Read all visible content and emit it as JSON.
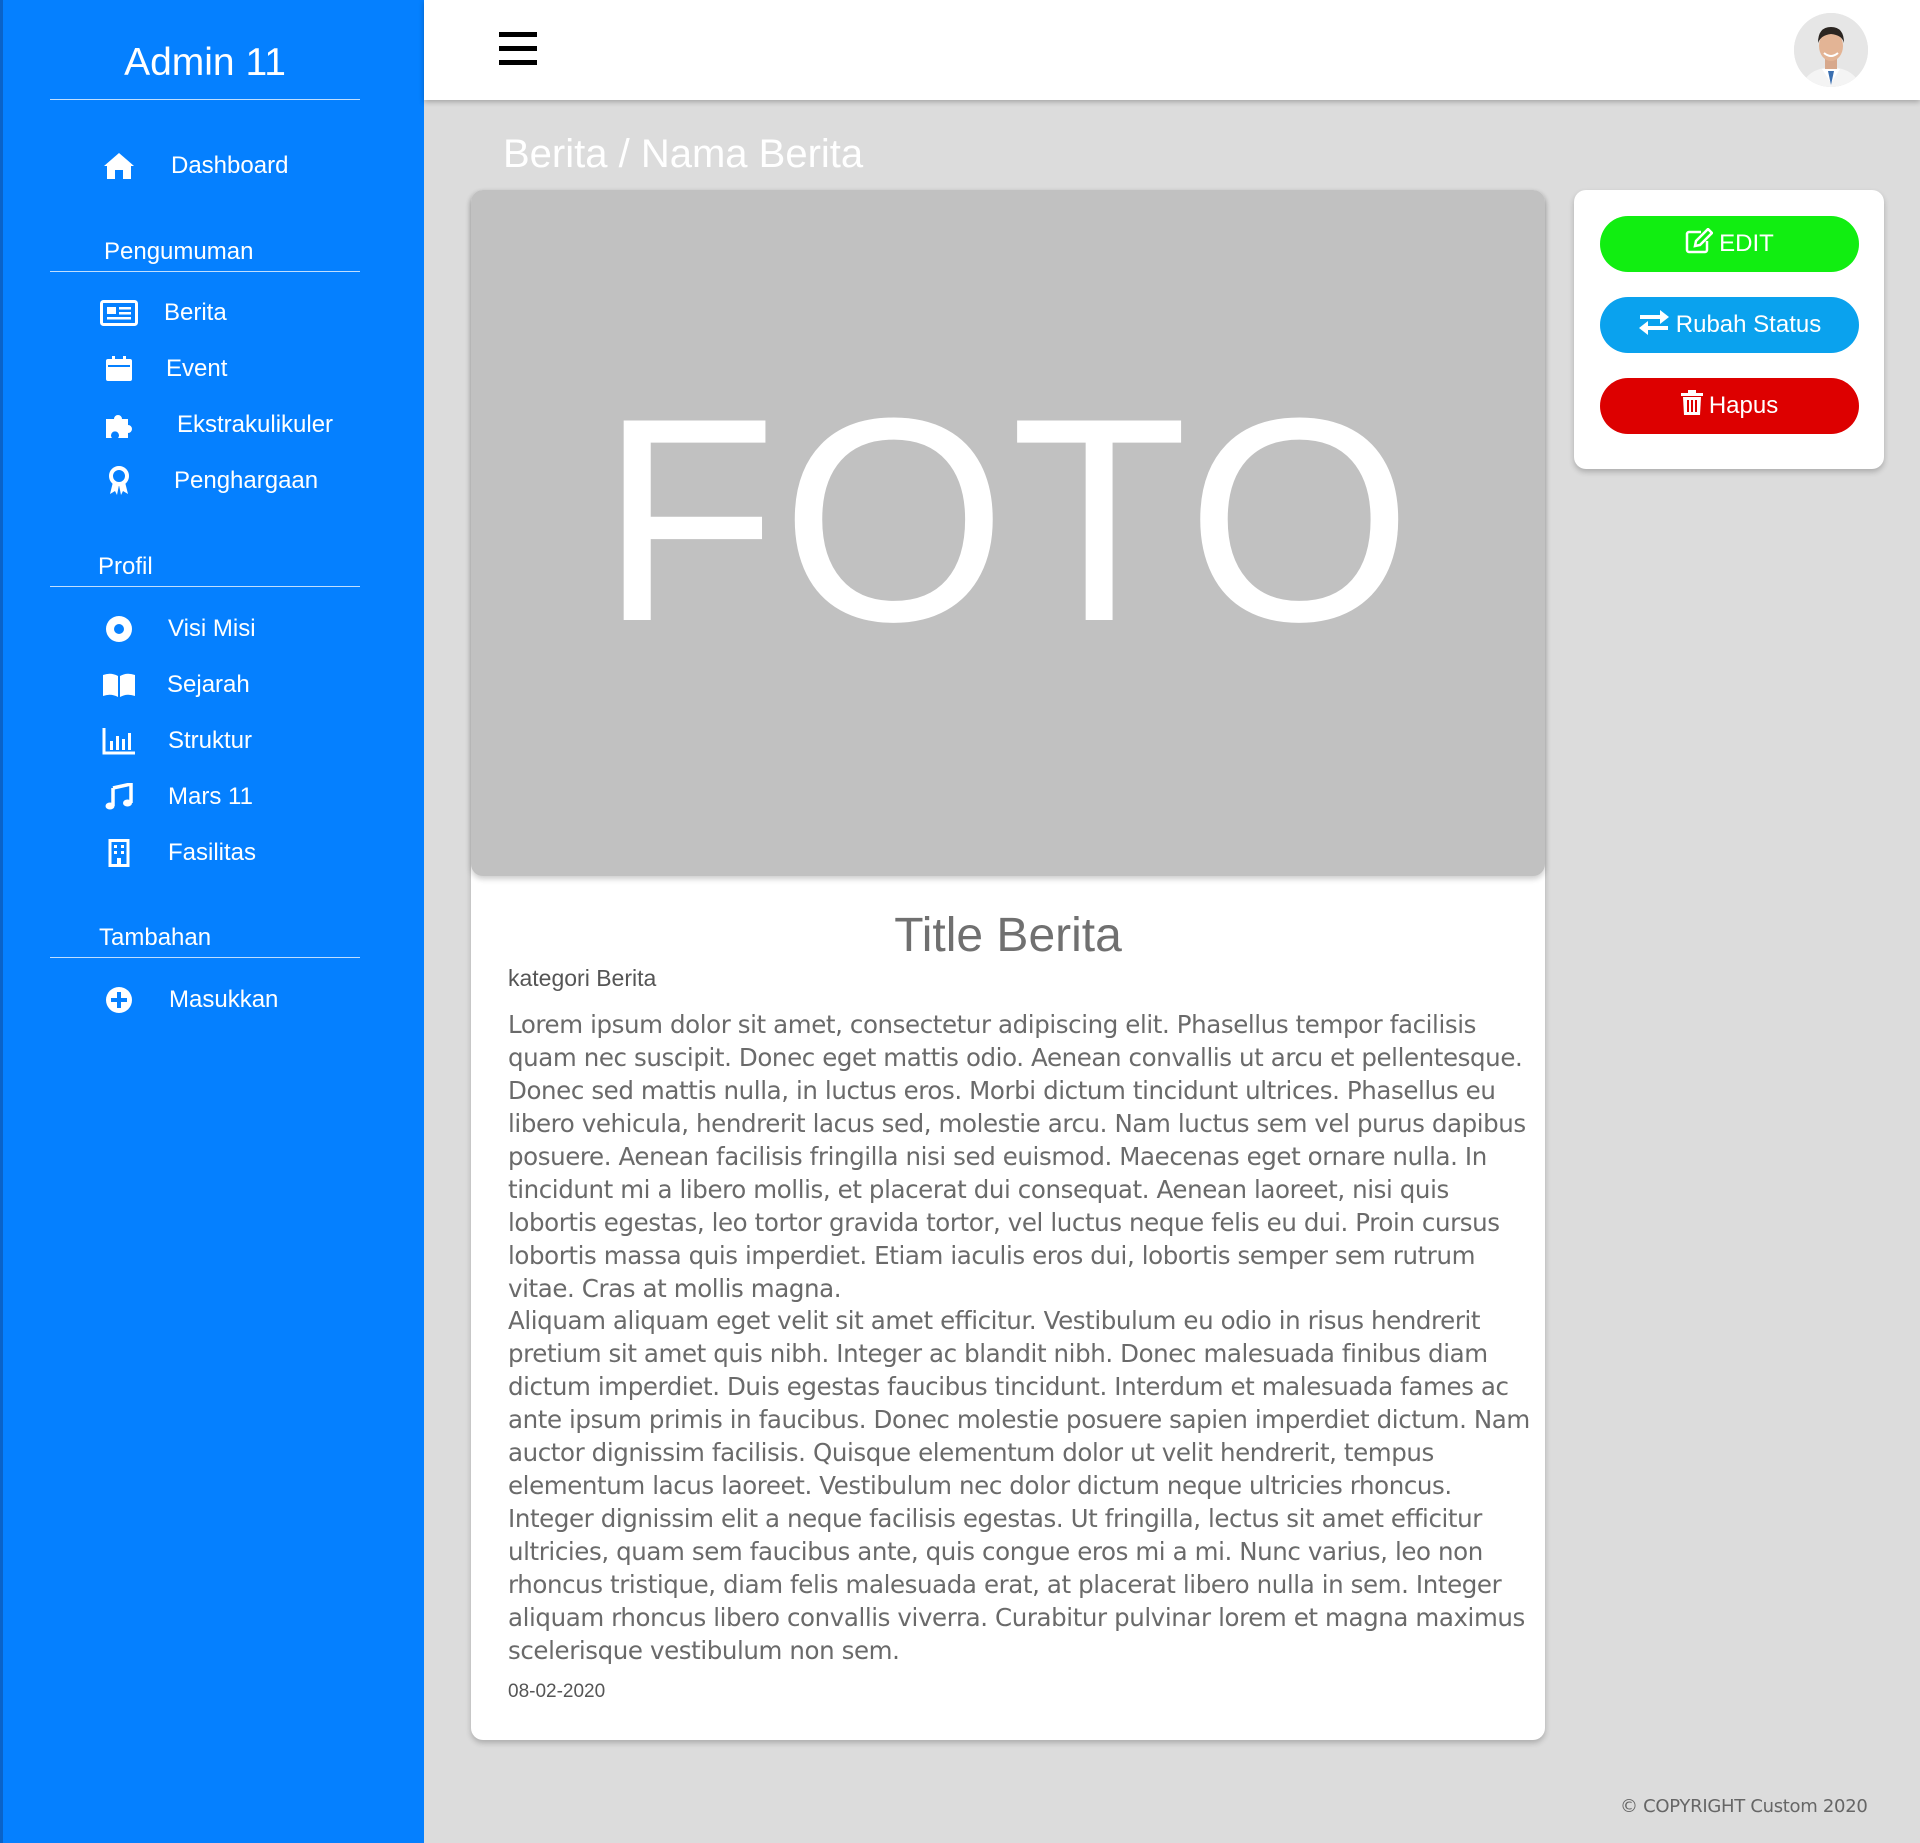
{
  "sidebar": {
    "brand": "Admin 11",
    "dashboard": "Dashboard",
    "sections": [
      {
        "title": "Pengumuman",
        "items": [
          "Berita",
          "Event",
          "Ekstrakulikuler",
          "Penghargaan"
        ]
      },
      {
        "title": "Profil",
        "items": [
          "Visi Misi",
          "Sejarah",
          "Struktur",
          "Mars 11",
          "Fasilitas"
        ]
      },
      {
        "title": "Tambahan",
        "items": [
          "Masukkan"
        ]
      }
    ]
  },
  "header": {
    "menu_icon": "hamburger-icon",
    "avatar": "user-avatar"
  },
  "breadcrumb": "Berita / Nama Berita",
  "news": {
    "photo_placeholder": "FOTO",
    "title": "Title Berita",
    "category": "kategori Berita",
    "paragraphs": [
      "Lorem ipsum dolor sit amet, consectetur adipiscing elit. Phasellus tempor facilisis quam nec suscipit. Donec eget mattis odio. Aenean convallis ut arcu et pellentesque. Donec sed mattis nulla, in luctus eros. Morbi dictum tincidunt ultrices. Phasellus eu libero vehicula, hendrerit lacus sed, molestie arcu. Nam luctus sem vel purus dapibus posuere. Aenean facilisis fringilla nisi sed euismod. Maecenas eget ornare nulla. In tincidunt mi a libero mollis, et placerat dui consequat. Aenean laoreet, nisi quis lobortis egestas, leo tortor gravida tortor, vel luctus neque felis eu dui. Proin cursus lobortis massa quis imperdiet. Etiam iaculis eros dui, lobortis semper sem rutrum vitae. Cras at mollis magna.",
      "Aliquam aliquam eget velit sit amet efficitur. Vestibulum eu odio in risus hendrerit pretium sit amet quis nibh. Integer ac blandit nibh. Donec malesuada finibus diam dictum imperdiet. Duis egestas faucibus tincidunt. Interdum et malesuada fames ac ante ipsum primis in faucibus. Donec molestie posuere sapien imperdiet dictum. Nam auctor dignissim facilisis. Quisque elementum dolor ut velit hendrerit, tempus elementum lacus laoreet. Vestibulum nec dolor dictum neque ultricies rhoncus. Integer dignissim elit a neque facilisis egestas. Ut fringilla, lectus sit amet efficitur ultricies, quam sem faucibus ante, quis congue eros mi a mi. Nunc varius, leo non rhoncus tristique, diam felis malesuada erat, at placerat libero nulla in sem. Integer aliquam rhoncus libero convallis viverra. Curabitur pulvinar lorem et magna maximus scelerisque vestibulum non sem."
    ],
    "date": "08-02-2020"
  },
  "actions": {
    "edit": "EDIT",
    "change_status": "Rubah Status",
    "delete": "Hapus"
  },
  "colors": {
    "sidebar": "#0580ff",
    "edit": "#11ee11",
    "status": "#0aa2ee",
    "delete": "#dd0000"
  },
  "footer": "© COPYRIGHT Custom 2020"
}
